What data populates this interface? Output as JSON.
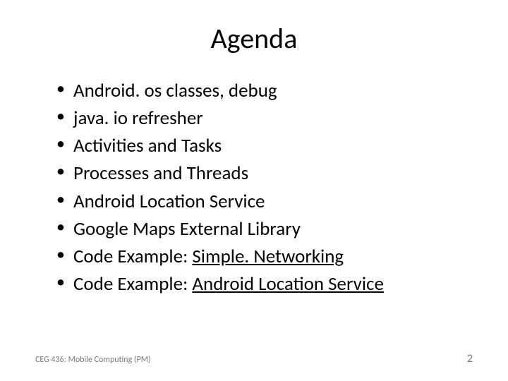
{
  "title": "Agenda",
  "items": [
    {
      "prefix": "Android. os classes, debug",
      "link": ""
    },
    {
      "prefix": "java. io refresher",
      "link": ""
    },
    {
      "prefix": "Activities and Tasks",
      "link": ""
    },
    {
      "prefix": "Processes and Threads",
      "link": ""
    },
    {
      "prefix": "Android Location Service",
      "link": ""
    },
    {
      "prefix": "Google Maps External Library",
      "link": ""
    },
    {
      "prefix": "Code Example: ",
      "link": "Simple. Networking"
    },
    {
      "prefix": "Code Example: ",
      "link": "Android Location Service"
    }
  ],
  "footer": {
    "left": "CEG 436: Mobile Computing (PM)",
    "right": "2"
  }
}
